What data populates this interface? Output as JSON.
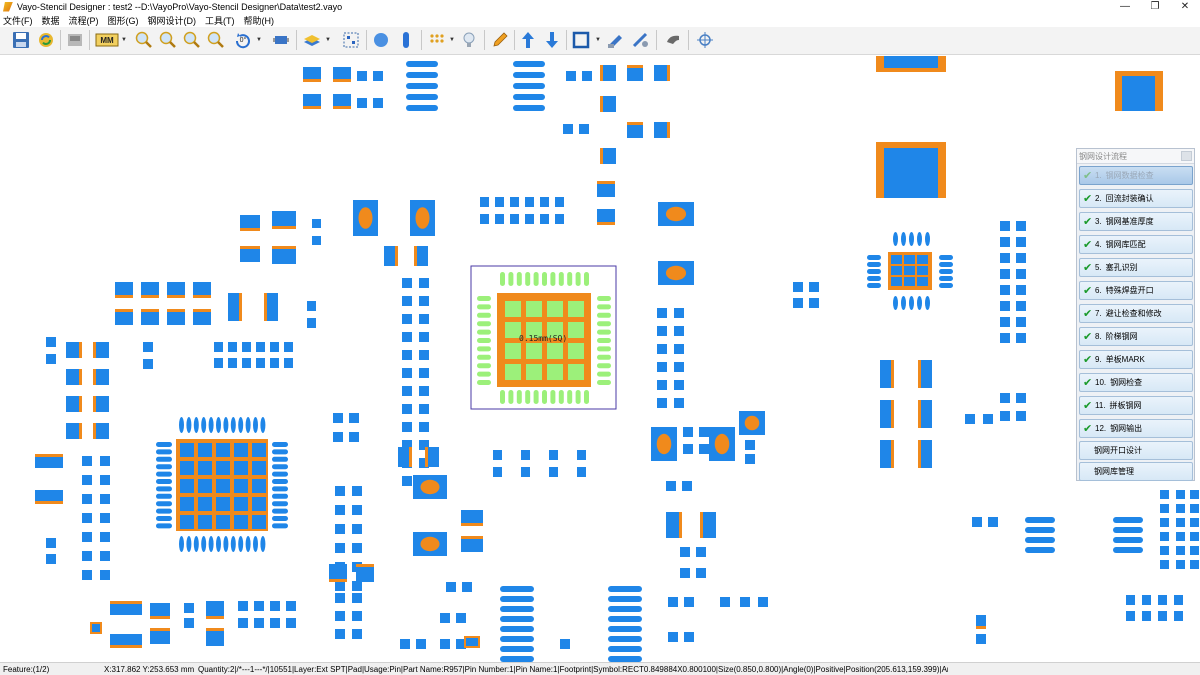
{
  "window": {
    "title": "Vayo-Stencil Designer : test2  --D:\\VayoPro\\Vayo-Stencil Designer\\Data\\test2.vayo",
    "minimize": "—",
    "maximize": "❐",
    "close": "✕"
  },
  "menu": [
    "文件(F)",
    "数据",
    "流程(P)",
    "图形(G)",
    "钢网设计(D)",
    "工具(T)",
    "帮助(H)"
  ],
  "toolbar": {
    "units_label": "MM",
    "rotation_label": "0°",
    "icons": [
      "save-icon",
      "refresh-icon",
      "import-icon",
      "units-icon",
      "zoom-in-icon",
      "zoom-out-icon",
      "zoom-window-icon",
      "zoom-fit-icon",
      "rotate-icon",
      "component-icon",
      "layer-icon",
      "select-icon",
      "circle-pad-icon",
      "oval-pad-icon",
      "grid-dots-icon",
      "bulb-icon",
      "pencil-icon",
      "arrow-up-icon",
      "arrow-down-icon",
      "square-icon",
      "edit-tools-icon",
      "settings-tools-icon",
      "hand-icon",
      "target-icon"
    ]
  },
  "canvas": {
    "selection_label": "0.15mm(SQ)",
    "colors": {
      "pad": "#1f86e8",
      "aperture": "#f08a1c",
      "selected_pad": "#9cf07a",
      "selection_box": "#4a3aa6"
    }
  },
  "panel": {
    "title": "钢网设计流程",
    "steps": [
      {
        "num": "1.",
        "label": "钢网数据检查",
        "state": "active"
      },
      {
        "num": "2.",
        "label": "回流封装确认",
        "state": "done"
      },
      {
        "num": "3.",
        "label": "钢网基准厚度",
        "state": "done"
      },
      {
        "num": "4.",
        "label": "钢网库匹配",
        "state": "done"
      },
      {
        "num": "5.",
        "label": "塞孔识别",
        "state": "done"
      },
      {
        "num": "6.",
        "label": "特殊焊盘开口",
        "state": "done"
      },
      {
        "num": "7.",
        "label": "避让检查和修改",
        "state": "done"
      },
      {
        "num": "8.",
        "label": "阶梯钢网",
        "state": "done"
      },
      {
        "num": "9.",
        "label": "单板MARK",
        "state": "done"
      },
      {
        "num": "10.",
        "label": "钢网检查",
        "state": "done"
      },
      {
        "num": "11.",
        "label": "拼板钢网",
        "state": "done"
      },
      {
        "num": "12.",
        "label": "钢网输出",
        "state": "done"
      }
    ],
    "extra_buttons": [
      "钢网开口设计",
      "钢网库管理"
    ]
  },
  "status": {
    "feature": "Feature:(1/2)",
    "coords": "X:317.862 Y:253.653 mm",
    "info": "Quantity:2|/*---1---*/|10551|Layer:Ext SPT|Pad|Usage:Pin|Part Name:R957|Pin Number:1|Pin Name:1|Footprint|Symbol:RECT0.849884X0.800100|Size(0.850,0.800)|Angle(0)|Positive|Position(205.613,159.399)|Area:"
  }
}
